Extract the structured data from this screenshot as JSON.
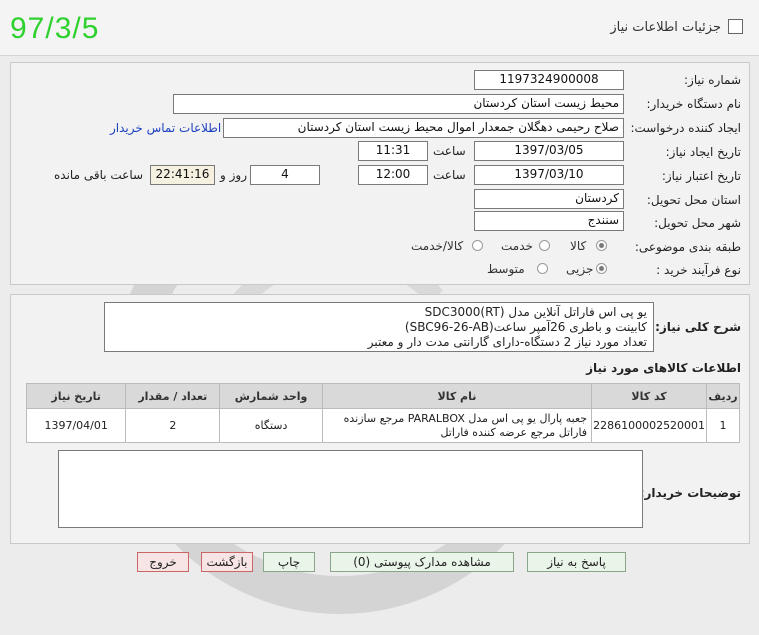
{
  "header": {
    "date": "97/3/5",
    "title": "جزئیات اطلاعات نیاز"
  },
  "labels": {
    "need_no": "شماره نیاز:",
    "buyer": "نام دستگاه خریدار:",
    "requester": "ایجاد کننده درخواست:",
    "created": "تاریخ ایجاد نیاز:",
    "deadline": "تاریخ اعتبار نیاز:",
    "province": "استان محل تحویل:",
    "city": "شهر محل تحویل:",
    "category": "طبقه بندی موضوعی:",
    "process": "نوع فرآیند خرید :",
    "time": "ساعت",
    "day_and": "روز و",
    "remaining": "ساعت باقی مانده",
    "general_desc": "شرح کلی نیاز:",
    "goods_info": "اطلاعات کالاهای مورد نیاز",
    "buyer_notes": "توضیحات خریدار:"
  },
  "fields": {
    "need_no": "1197324900008",
    "buyer": "محیط زیست استان کردستان",
    "requester": "صلاح  رحیمی دهگلان جمعدار اموال محیط زیست استان کردستان",
    "contact_link": "اطلاعات تماس خریدار",
    "created_date": "1397/03/05",
    "created_time": "11:31",
    "deadline_date": "1397/03/10",
    "deadline_time": "12:00",
    "days": "4",
    "remaining_time": "22:41:16",
    "province": "کردستان",
    "city": "سنندج"
  },
  "category": {
    "options": [
      "کالا",
      "خدمت",
      "کالا/خدمت"
    ],
    "selected": "کالا"
  },
  "process": {
    "options": [
      "جزیی",
      "متوسط"
    ],
    "selected": "جزیی"
  },
  "description": {
    "line1": "یو پی اس فاراتل آنلاین مدل SDC3000(RT)",
    "line2": "کابینت و باطری 26آمپر ساعت(SBC96-26-AB)",
    "line3": "تعداد مورد نیاز 2 دستگاه-دارای گارانتی مدت دار و معتبر"
  },
  "table": {
    "headers": [
      "ردیف",
      "کد کالا",
      "نام کالا",
      "واحد شمارش",
      "تعداد / مقدار",
      "تاریخ نیاز"
    ],
    "rows": [
      {
        "index": "1",
        "code": "2286100002520001",
        "name": "جعبه پارال یو پی اس مدل PARALBOX مرجع سازنده فاراتل مرجع عرضه کننده فاراتل",
        "unit": "دستگاه",
        "qty": "2",
        "date": "1397/04/01"
      }
    ]
  },
  "buttons": {
    "reply": "پاسخ به نیاز",
    "attachments": "مشاهده مدارک پیوستی (0)",
    "print": "چاپ",
    "back": "بازگشت",
    "exit": "خروج"
  },
  "colors": {
    "date_green": "#2fd12f",
    "link_blue": "#1b3fbf"
  }
}
